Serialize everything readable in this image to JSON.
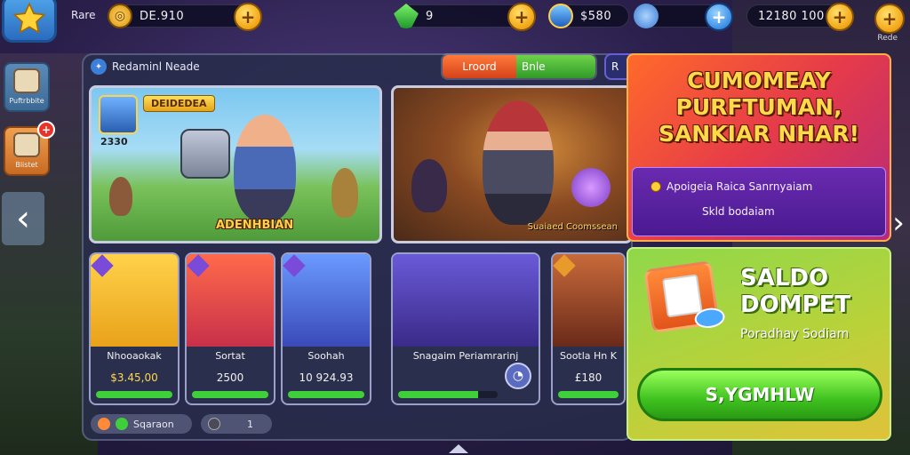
{
  "topbar": {
    "player_name": "Rare",
    "resources": [
      {
        "icon": "coin-icon",
        "value": "DE.910"
      },
      {
        "icon": "emerald-gem-icon",
        "value": "9"
      },
      {
        "icon": "blue-gem-icon",
        "value": "$580"
      },
      {
        "icon": "crystal-icon",
        "value": ""
      },
      {
        "icon": "gold-icon",
        "value": "12180 100"
      }
    ],
    "corner_label": "Rede"
  },
  "sidebar": {
    "items": [
      {
        "label": "Puftrbbite",
        "icon": "shop-icon"
      },
      {
        "label": "Blistet",
        "icon": "shop-icon",
        "badge": "+"
      }
    ]
  },
  "panel": {
    "title": "Redaminl Neade",
    "toggle_left": "Lroord",
    "toggle_right": "Bnle",
    "toggle_extra": "R",
    "hero1": {
      "badge": "DEIDEDEA",
      "level": "2330",
      "name": "ADENHBIAN"
    },
    "hero2": {
      "name": "Suaiaed Coomssean"
    },
    "cards": [
      {
        "name": "Nhooaokak",
        "price": "$3.45,00",
        "progress": 1.0
      },
      {
        "name": "Sortat",
        "price": "2500",
        "progress": 1.0
      },
      {
        "name": "Soohah",
        "price": "10 924.93",
        "progress": 1.0
      },
      {
        "name": "Snagaim Periamrarinj",
        "price": "",
        "progress": 0.8
      },
      {
        "name": "Sootla Hn K",
        "price": "£180",
        "progress": 1.0
      }
    ],
    "footer": {
      "chip1": "Sqaraon",
      "chip2": "1"
    }
  },
  "promo": {
    "title_line1": "CUMOMEAY",
    "title_line2": "PURFTUMAN,",
    "title_line3": "SANKIAR NHAR!",
    "line1": "Apoigeia Raica Sanrnyaiam",
    "line2": "Skld bodaiam"
  },
  "wallet": {
    "title_line1": "SALDO",
    "title_line2": "DOMPET",
    "subtitle": "Poradhay Sodiam",
    "button": "S,YGMHLW"
  },
  "colors": {
    "accent_gold": "#f2a516",
    "accent_blue": "#3c8ee6",
    "progress_green": "#3fcf3a",
    "promo_red": "#e53a4a",
    "wallet_green": "#3fc21f"
  }
}
